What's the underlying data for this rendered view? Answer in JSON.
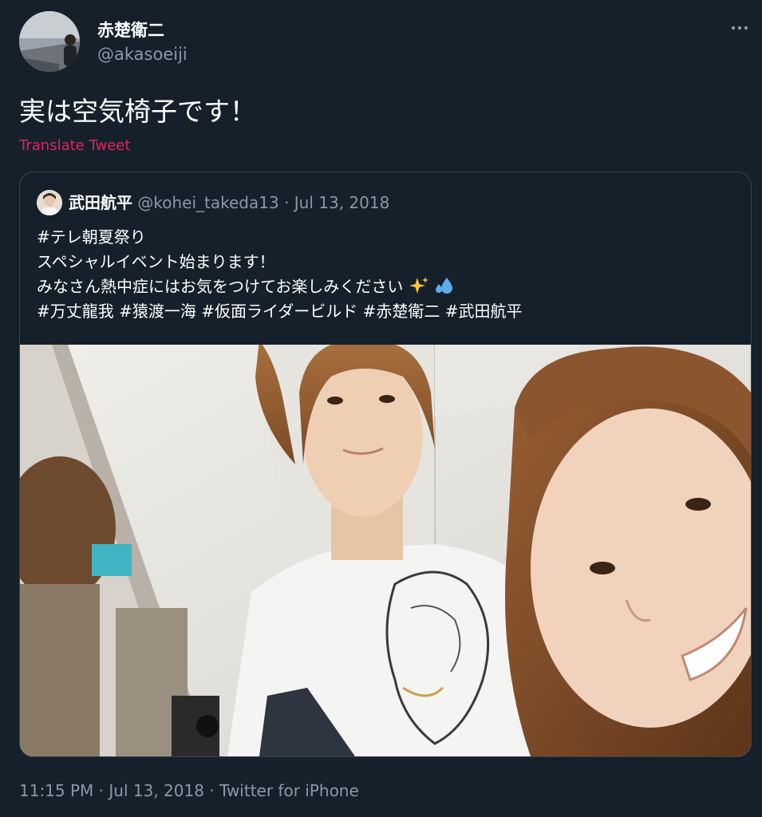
{
  "author": {
    "display_name": "赤楚衛二",
    "handle": "@akasoeiji"
  },
  "tweet": {
    "text": "実は空気椅子です！",
    "translate_label": "Translate Tweet"
  },
  "quoted_tweet": {
    "display_name": "武田航平",
    "handle": "@kohei_takeda13",
    "separator": " · ",
    "date": "Jul 13, 2018",
    "lines": [
      "#テレ朝夏祭り",
      "スペシャルイベント始まります！",
      "みなさん熱中症にはお気をつけてお楽しみください"
    ],
    "emojis": [
      "sparkles-icon",
      "sweat-droplets-icon"
    ],
    "hashtags": [
      "#万丈龍我",
      "#猿渡一海",
      "#仮面ライダービルド",
      "#赤楚衛二",
      "#武田航平"
    ]
  },
  "footer": {
    "time": "11:15 PM",
    "date": "Jul 13, 2018",
    "source": "Twitter for iPhone",
    "separator": " · "
  },
  "colors": {
    "background": "#15202b",
    "secondary_text": "#8b98a5",
    "translate_link": "#e0245e",
    "border": "#38444d"
  }
}
